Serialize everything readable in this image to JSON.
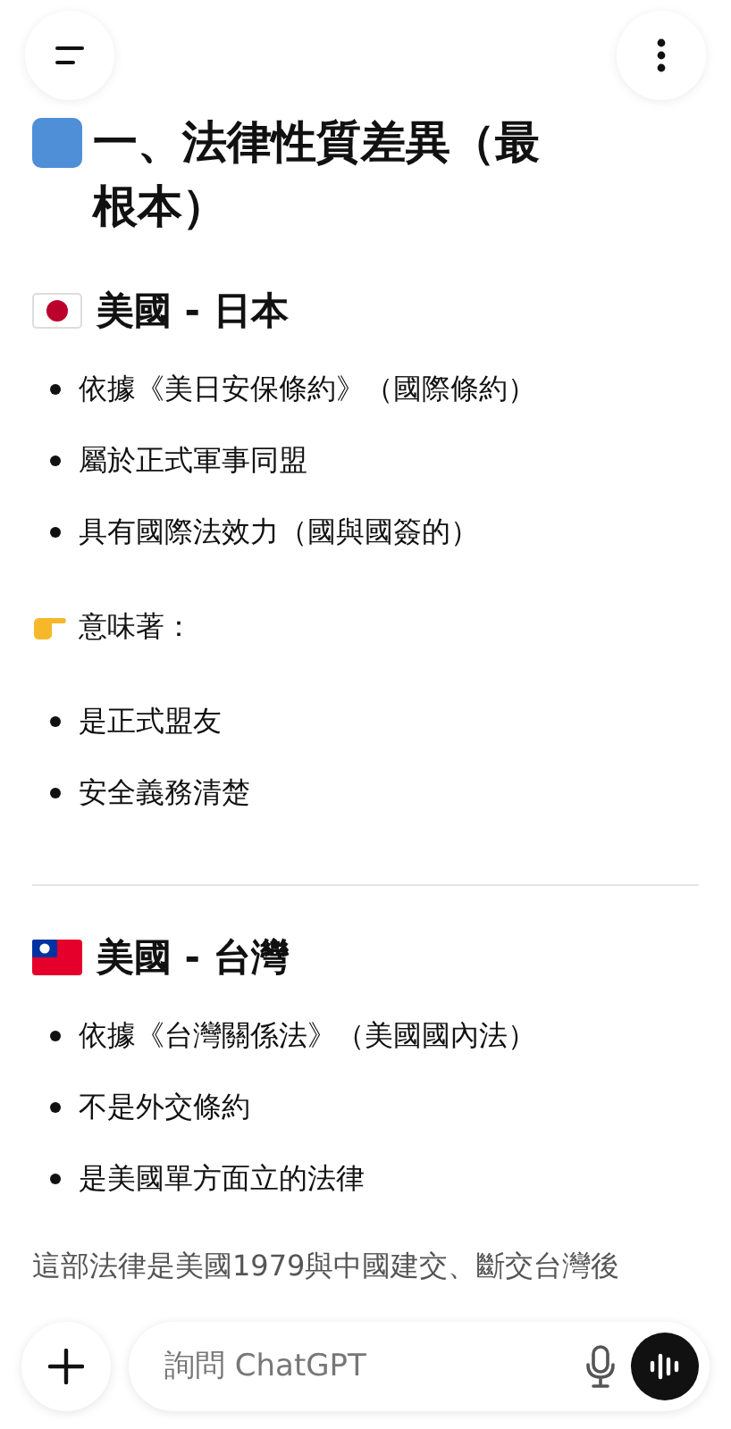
{
  "heading": "一、法律性質差異（最根本）",
  "sections": [
    {
      "kind": "japan",
      "title": "美國 - 日本",
      "bullets": [
        "依據《美日安保條約》（國際條約）",
        "屬於正式軍事同盟",
        "具有國際法效力（國與國簽的）"
      ],
      "note": "意味著：",
      "note_bullets": [
        "是正式盟友",
        "安全義務清楚"
      ]
    },
    {
      "kind": "taiwan",
      "title": "美國 - 台灣",
      "bullets": [
        "依據《台灣關係法》（美國國內法）",
        "不是外交條約",
        "是美國單方面立的法律"
      ],
      "paragraph": "這部法律是美國1979與中國建交、斷交台灣後"
    }
  ],
  "composer": {
    "placeholder": "詢問 ChatGPT"
  }
}
